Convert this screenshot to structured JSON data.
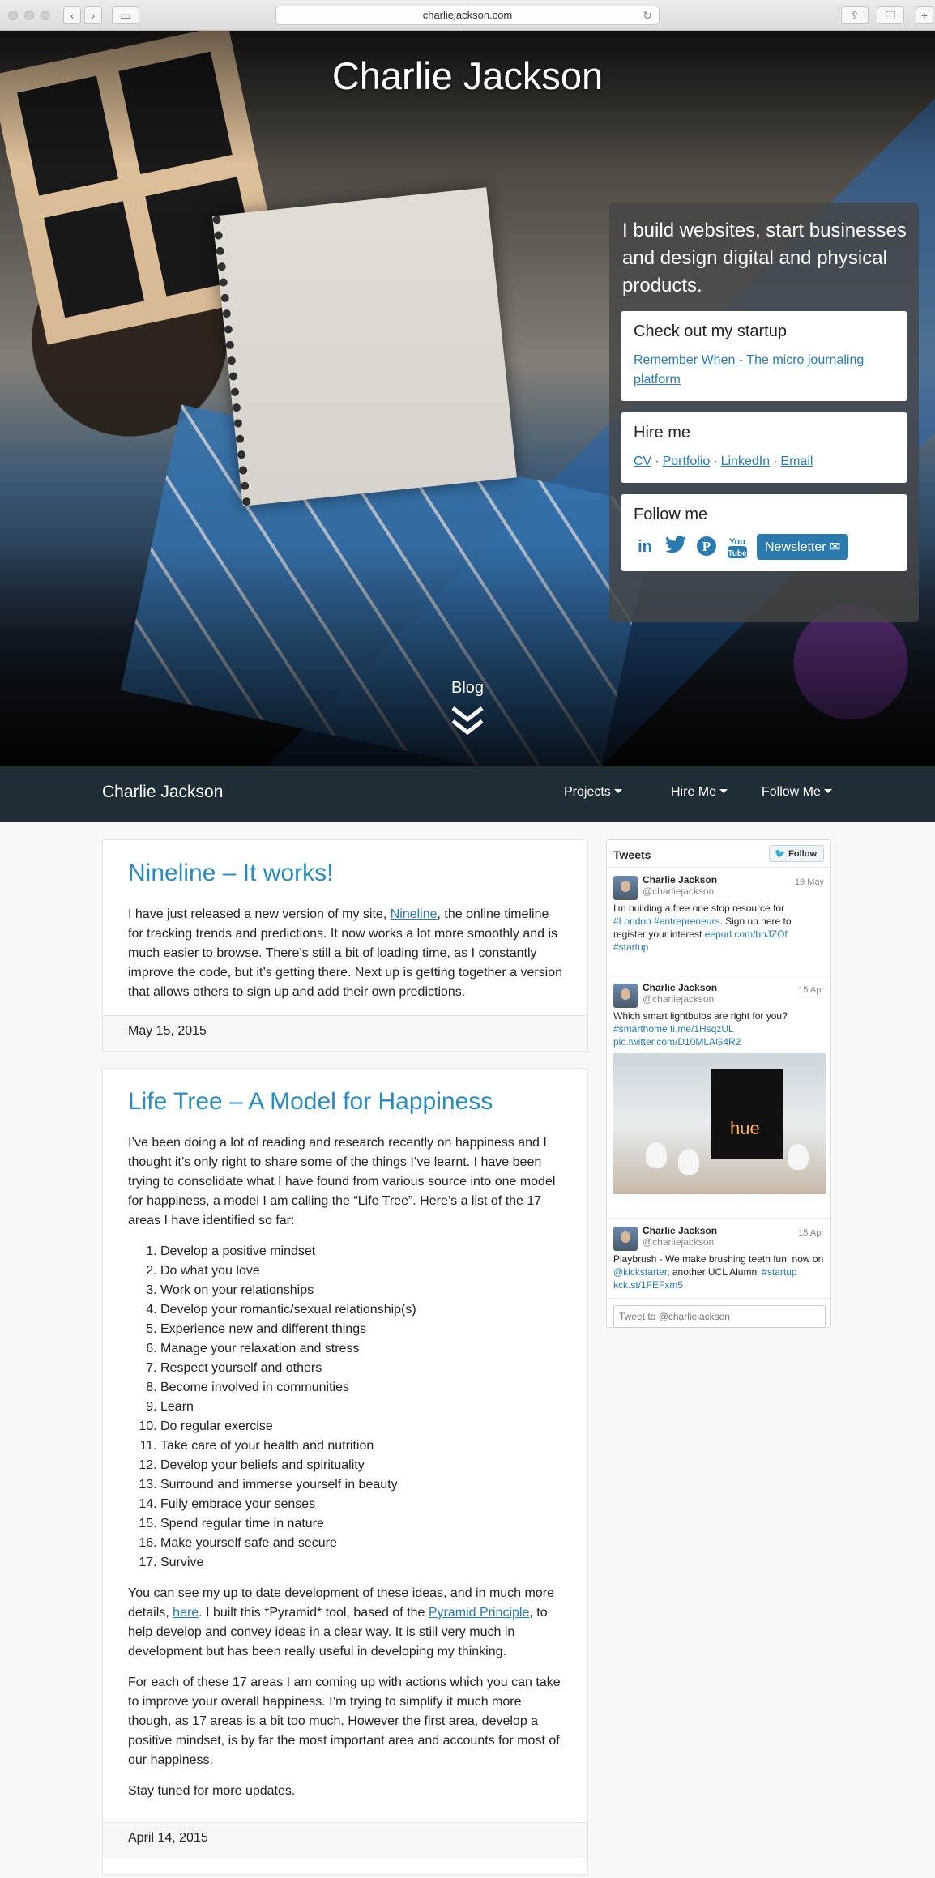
{
  "browser": {
    "url": "charliejackson.com"
  },
  "hero": {
    "title": "Charlie Jackson",
    "tagline": "I build websites, start businesses and design digital and physical products.",
    "startup": {
      "heading": "Check out my startup",
      "link": "Remember When - The micro journaling platform"
    },
    "hire": {
      "heading": "Hire me",
      "links": [
        "CV",
        "Portfolio",
        "LinkedIn",
        "Email"
      ]
    },
    "follow": {
      "heading": "Follow me",
      "newsletter": "Newsletter ✉"
    },
    "blog_link": "Blog"
  },
  "navbar": {
    "brand": "Charlie Jackson",
    "items": [
      "Projects",
      "Hire Me",
      "Follow Me"
    ]
  },
  "posts": [
    {
      "title": "Nineline – It works!",
      "p1_pre": "I have just released a new version of my site, ",
      "p1_link": "Nineline",
      "p1_post": ", the online timeline for tracking trends and predictions. It now works a lot more smoothly and is much easier to browse. There’s still a bit of loading time, as I constantly improve the code, but it’s getting there. Next up is getting together a version that allows others to sign up and add their own predictions.",
      "date": "May 15, 2015"
    },
    {
      "title": "Life Tree – A Model for Happiness",
      "intro": "I’ve been doing a lot of reading and research recently on happiness and I thought it’s only right to share some of the things I’ve learnt.  I have been trying to consolidate what I have found from various source into one model for happiness, a model I am calling the “Life Tree”. Here’s a list of the 17 areas I have identified so far:",
      "list": [
        "Develop a positive mindset",
        "Do what you love",
        "Work on your relationships",
        "Develop your romantic/sexual relationship(s)",
        "Experience new and different things",
        "Manage your relaxation and stress",
        "Respect yourself and others",
        "Become involved in communities",
        "Learn",
        "Do regular exercise",
        "Take care of your health and nutrition",
        "Develop your beliefs and spirituality",
        "Surround and immerse yourself in beauty",
        "Fully embrace your senses",
        "Spend regular time in nature",
        "Make yourself safe and secure",
        "Survive"
      ],
      "p2_a": "You can see my up to date development of these ideas, and in much more details, ",
      "p2_link1": "here",
      "p2_b": ". I built this *Pyramid* tool, based of the ",
      "p2_link2": "Pyramid Principle",
      "p2_c": ", to help develop and convey ideas in a clear way. It is still very much in development but has been really useful in developing my thinking.",
      "p3": "For each of these 17 areas I am coming up with actions which you can take to improve your overall happiness. I’m trying to simplify it much more though, as 17 areas is a bit too much. However the first area, develop a positive mindset, is by far the most important area and accounts for most of our happiness.",
      "p4": "Stay tuned for more updates.",
      "date": "April 14, 2015"
    }
  ],
  "tweets": {
    "heading": "Tweets",
    "follow": "Follow",
    "items": [
      {
        "name": "Charlie Jackson",
        "handle": "@charliejackson",
        "date": "19 May",
        "text": "I'm building a free one stop resource for ",
        "links": "#London #entrepreneurs",
        "text2": ". Sign up here to register your interest ",
        "link2": "eepurl.com/bnJZOf",
        "link3": "#startup"
      },
      {
        "name": "Charlie Jackson",
        "handle": "@charliejackson",
        "date": "15 Apr",
        "text": "Which smart lightbulbs are right for you?",
        "links": "#smarthome ti.me/1HsqzUL",
        "link2": "pic.twitter.com/D10MLAG4R2",
        "image_label": "hue"
      },
      {
        "name": "Charlie Jackson",
        "handle": "@charliejackson",
        "date": "15 Apr",
        "text": "Playbrush - We make brushing teeth fun, now on ",
        "link1": "@kickstarter",
        "text2": ", another UCL Alumni ",
        "link2": "#startup",
        "link3": "kck.st/1FEFxm5"
      }
    ],
    "input_placeholder": "Tweet to @charliejackson"
  },
  "colors": {
    "accent": "#2a8bbd",
    "navbar": "#1f2e36",
    "link": "#2a7ab0"
  }
}
